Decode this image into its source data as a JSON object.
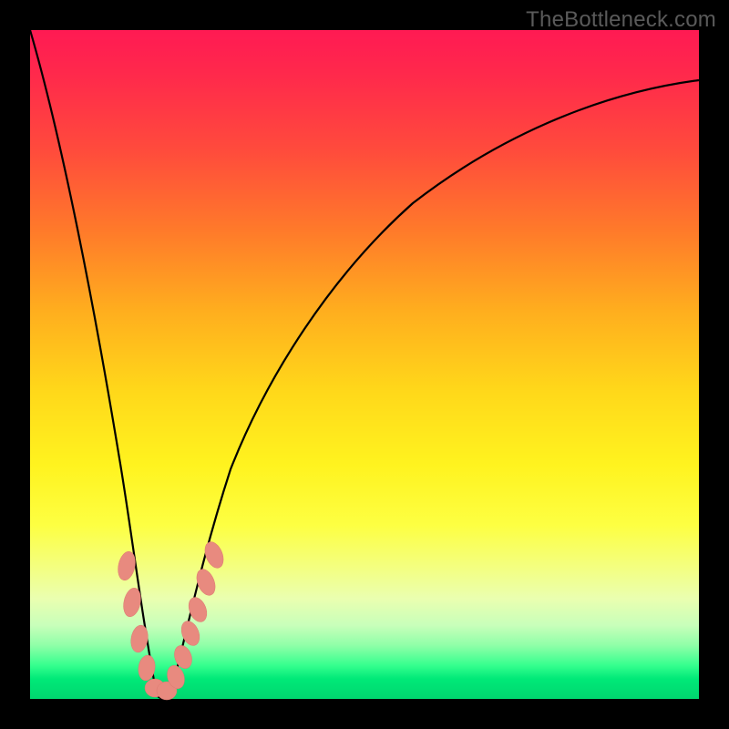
{
  "watermark": {
    "text": "TheBottleneck.com"
  },
  "chart_data": {
    "type": "line",
    "title": "",
    "xlabel": "",
    "ylabel": "",
    "xlim": [
      0,
      100
    ],
    "ylim": [
      0,
      100
    ],
    "grid": false,
    "series": [
      {
        "name": "bottleneck-curve",
        "x": [
          0,
          5,
          10,
          13,
          15,
          17,
          18,
          19,
          20,
          21,
          22,
          25,
          30,
          40,
          50,
          60,
          70,
          80,
          90,
          100
        ],
        "values": [
          100,
          75,
          48,
          30,
          17,
          6,
          2,
          0,
          0,
          2,
          6,
          18,
          34,
          55,
          68,
          77,
          83,
          87,
          90,
          92
        ]
      }
    ],
    "markers": {
      "name": "recommendation-points",
      "color": "#e88a7f",
      "points": [
        {
          "x": 14.5,
          "y": 19
        },
        {
          "x": 15.0,
          "y": 14
        },
        {
          "x": 15.5,
          "y": 10
        },
        {
          "x": 16.2,
          "y": 5
        },
        {
          "x": 17.0,
          "y": 3
        },
        {
          "x": 18.0,
          "y": 1
        },
        {
          "x": 19.0,
          "y": 0
        },
        {
          "x": 20.0,
          "y": 0
        },
        {
          "x": 21.0,
          "y": 2.5
        },
        {
          "x": 21.5,
          "y": 5.5
        },
        {
          "x": 22.0,
          "y": 8
        },
        {
          "x": 22.5,
          "y": 10.5
        },
        {
          "x": 23.0,
          "y": 13
        },
        {
          "x": 23.8,
          "y": 17
        },
        {
          "x": 24.5,
          "y": 20.5
        }
      ]
    }
  }
}
